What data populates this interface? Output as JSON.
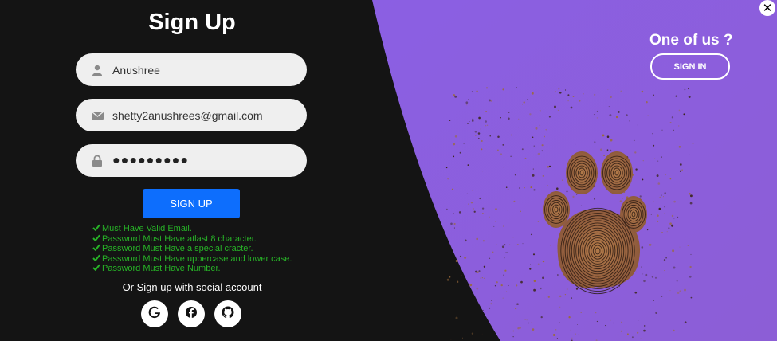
{
  "signup": {
    "title": "Sign Up",
    "name_value": "Anushree",
    "email_value": "shetty2anushrees@gmail.com",
    "password_value": "●●●●●●●●●",
    "button_label": "SIGN UP"
  },
  "rules": [
    "Must Have Valid Email.",
    "Password Must Have atlast 8 character.",
    "Password Must Have a special cracter.",
    "Password Must Have uppercase and lower case.",
    "Password Must Have Number."
  ],
  "social": {
    "text": "Or Sign up with social account",
    "icons": [
      "google-icon",
      "facebook-icon",
      "github-icon"
    ]
  },
  "panel": {
    "heading": "One of us ?",
    "button_label": "SIGN IN"
  },
  "icons": {
    "close": "close-icon",
    "name": "user-icon",
    "email": "envelope-icon",
    "password": "lock-icon",
    "check": "check-icon"
  },
  "colors": {
    "background": "#141414",
    "purple": "#8a5ee0",
    "accent": "#0d6efd",
    "rule_text": "#27b327"
  }
}
